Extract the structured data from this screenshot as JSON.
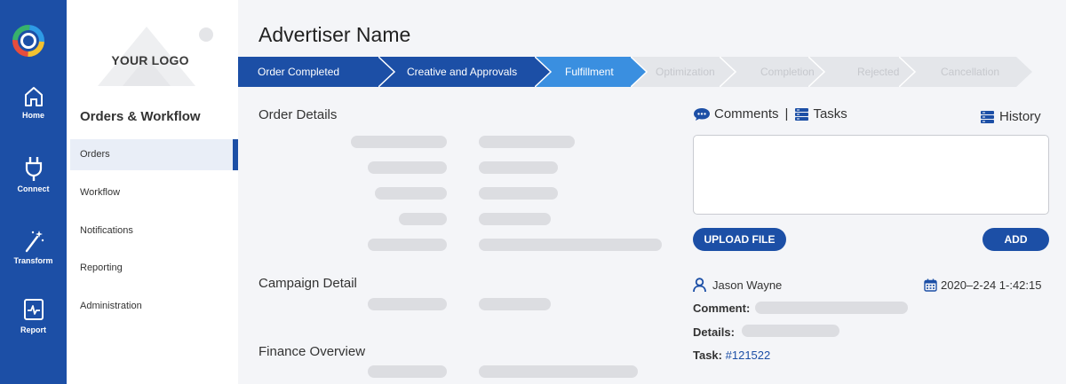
{
  "rail": {
    "items": [
      {
        "label": "Home",
        "icon": "home-icon"
      },
      {
        "label": "Connect",
        "icon": "plug-icon"
      },
      {
        "label": "Transform",
        "icon": "magic-wand-icon"
      },
      {
        "label": "Report",
        "icon": "pulse-report-icon"
      }
    ]
  },
  "subnav": {
    "logo_text": "YOUR LOGO",
    "title": "Orders & Workflow",
    "items": [
      {
        "label": "Orders",
        "active": true
      },
      {
        "label": "Workflow"
      },
      {
        "label": "Notifications"
      },
      {
        "label": "Reporting"
      },
      {
        "label": "Administration"
      }
    ]
  },
  "header": {
    "title": "Advertiser Name"
  },
  "stepper": {
    "steps": [
      {
        "label": "Order Completed",
        "state": "done"
      },
      {
        "label": "Creative and Approvals",
        "state": "done"
      },
      {
        "label": "Fulfillment",
        "state": "current"
      },
      {
        "label": "Optimization",
        "state": "pending"
      },
      {
        "label": "Completion",
        "state": "pending"
      },
      {
        "label": "Rejected",
        "state": "pending"
      },
      {
        "label": "Cancellation",
        "state": "pending"
      }
    ]
  },
  "sections": {
    "order_details": "Order Details",
    "campaign_detail": "Campaign Detail",
    "finance_overview": "Finance Overview"
  },
  "comments": {
    "tab_comments": "Comments",
    "separator": "|",
    "tab_tasks": "Tasks",
    "history": "History",
    "upload_label": "UPLOAD FILE",
    "add_label": "ADD",
    "author": "Jason Wayne",
    "timestamp": "2020–2-24 1-:42:15",
    "comment_label": "Comment:",
    "details_label": "Details:",
    "task_label": "Task:",
    "task_link": "#121522"
  },
  "colors": {
    "brand": "#1c4fa6",
    "current_step": "#3a8fe0",
    "pending_step": "#e4e6ea"
  }
}
